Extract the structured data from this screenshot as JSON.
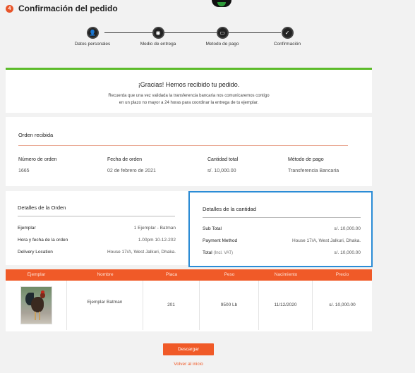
{
  "header": {
    "step_number": "4",
    "title": "Confirmación del pedido"
  },
  "stepper": {
    "steps": [
      {
        "label": "Datos personales",
        "icon": "user-icon",
        "glyph": "👤"
      },
      {
        "label": "Medio de entrega",
        "icon": "delivery-icon",
        "glyph": "◉"
      },
      {
        "label": "Metodo de pago",
        "icon": "card-icon",
        "glyph": "▭"
      },
      {
        "label": "Confirmación",
        "icon": "check-icon",
        "glyph": "✓"
      }
    ]
  },
  "thanks": {
    "title": "¡Gracias! Hemos recibido tu pedido.",
    "line1": "Recuerda que una vez validada la transferencia bancaria nos comunicaremos contigo",
    "line2": "en un plazo no mayor a  24 horas para coordinar la entrega de tu ejemplar."
  },
  "order": {
    "title": "Orden recibida",
    "number_label": "Número de orden",
    "number_value": "1665",
    "date_label": "Fecha de orden",
    "date_value": "02 de febrero de 2021",
    "total_label": "Cantidad total",
    "total_value": "s/. 10,000.00",
    "method_label": "Método de pago",
    "method_value": "Transferencia Bancaria"
  },
  "details": {
    "title": "Detalles de la Orden",
    "rows": [
      {
        "key": "Ejemplar",
        "value": "1 Ejemplar - Batman"
      },
      {
        "key": "Hora y fecha de la orden",
        "value": "1.00pm 10-12-202"
      },
      {
        "key": "Delivery Location",
        "value": "House 17/A, West Jalkuri, Dhaka."
      }
    ]
  },
  "amount": {
    "title": "Detalles de la cantidad",
    "subtotal_label": "Sub Total",
    "subtotal_value": "s/. 10,000.00",
    "payment_label": "Payment Method",
    "payment_value": "House 17/A, West Jalkuri, Dhaka.",
    "total_label": "Total",
    "total_note": "(Incl. VAT)",
    "total_value": "s/. 10,000.00"
  },
  "table": {
    "headers": [
      "Ejemplar",
      "Nombre",
      "Placa",
      "Peso",
      "Nacimiento",
      "Precio"
    ],
    "row": {
      "nombre": "Ejemplar Batman",
      "placa": "201",
      "peso": "9500 Lb",
      "nacimiento": "11/12/2020",
      "precio": "s/. 10,000.00"
    }
  },
  "actions": {
    "download_label": "Descargar",
    "back_label": "Volver al inicio"
  },
  "colors": {
    "accent": "#f05a28",
    "success": "#5cbb2a",
    "highlight": "#2b8cd6"
  }
}
